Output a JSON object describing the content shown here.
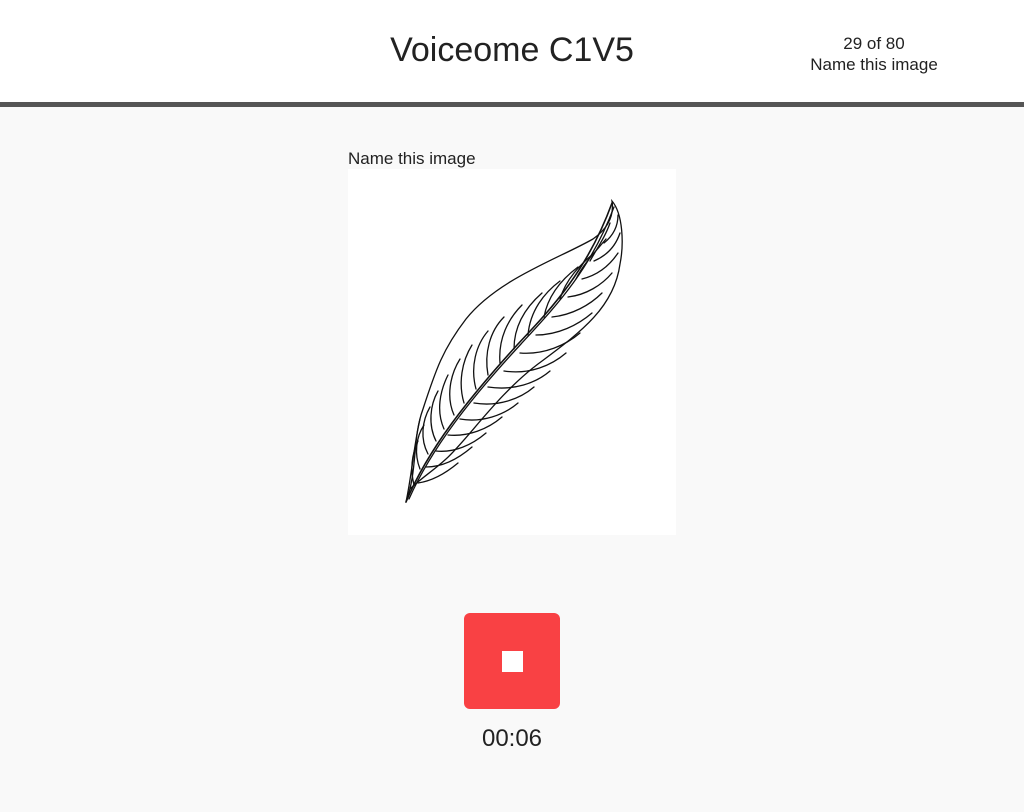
{
  "header": {
    "title": "Voiceome C1V5",
    "progress": "29 of 80",
    "task_label": "Name this image"
  },
  "main": {
    "prompt": "Name this image",
    "image_icon": "feather-drawing",
    "record_button_icon": "stop-icon",
    "timer": "00:06"
  },
  "colors": {
    "accent": "#f94144",
    "header_border": "#555555",
    "background": "#f9f9f9"
  }
}
